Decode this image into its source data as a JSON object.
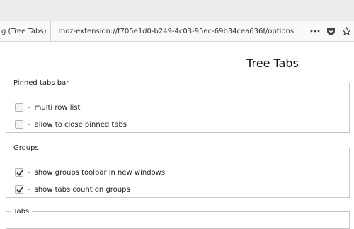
{
  "browser": {
    "tab_title": "g (Tree Tabs)",
    "url": "moz-extension://f705e1d0-b249-4c03-95ec-69b34cea636f/options",
    "icons": [
      "more-dots-icon",
      "pocket-icon",
      "bookmark-star-icon"
    ]
  },
  "page": {
    "title": "Tree Tabs"
  },
  "sections": [
    {
      "legend": "Pinned tabs bar",
      "options": [
        {
          "label": "multi row list",
          "checked": false
        },
        {
          "label": "allow to close pinned tabs",
          "checked": false
        }
      ]
    },
    {
      "legend": "Groups",
      "options": [
        {
          "label": "show groups toolbar in new windows",
          "checked": true
        },
        {
          "label": "show tabs count on groups",
          "checked": true
        }
      ]
    },
    {
      "legend": "Tabs",
      "options": []
    }
  ],
  "colors": {
    "accent_check": "#333333",
    "border": "#c8c8c8"
  }
}
